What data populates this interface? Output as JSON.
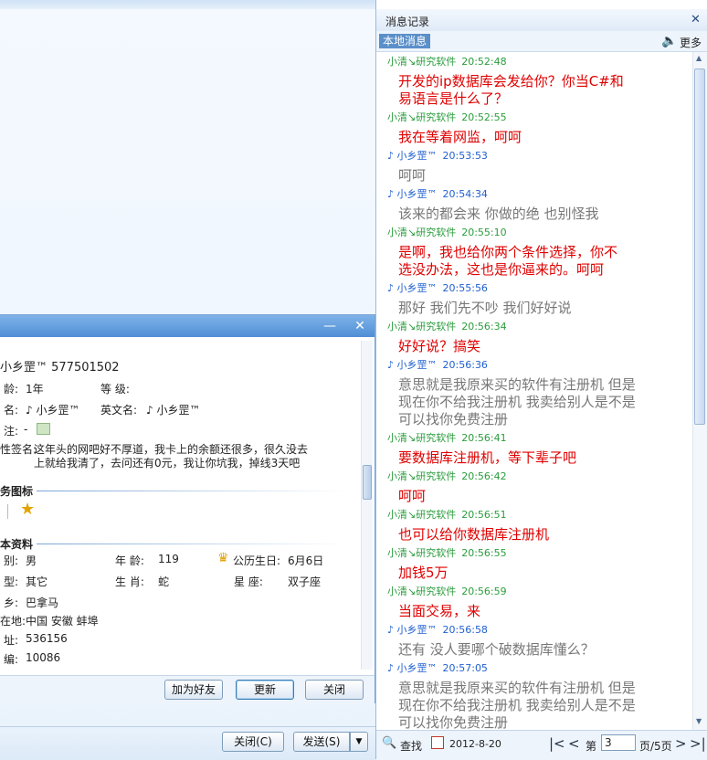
{
  "profile": {
    "name_number": "小乡罡™   577501502",
    "age_label": "龄:",
    "age_value": "1年",
    "level_label": "等  级:",
    "nick_label": "名:",
    "nick_value": "♪ 小乡罡™",
    "en_label": "英文名:",
    "en_value": "♪ 小乡罡™",
    "note_label": "注:",
    "note_value": "-",
    "sign_label": "性签名:",
    "sign_line1": "这年头的网吧好不厚道，我卡上的余额还很多，很久没去",
    "sign_line2": "上就给我清了，去问还有0元，我让你坑我，掉线3天吧",
    "icons_title": "务图标",
    "detail_title": "本资料",
    "gender_label": "别:",
    "gender_value": "男",
    "age2_label": "年  龄:",
    "age2_value": "119",
    "birthday_label": "公历生日:",
    "birthday_value": "6月6日",
    "blood_label": "型:",
    "blood_value": "其它",
    "zodiac_label": "生  肖:",
    "zodiac_value": "蛇",
    "star_label": "星  座:",
    "star_value": "双子座",
    "home_label": "乡:",
    "home_value": "巴拿马",
    "loc_label": "在地:",
    "loc_value": "中国 安徽 蚌埠",
    "addr_label": "址:",
    "addr_value": "536156",
    "zip_label": "编:",
    "zip_value": "10086",
    "buttons": {
      "add_friend": "加为好友",
      "update": "更新",
      "close": "关闭"
    },
    "title_controls": {
      "minimize": "—",
      "close": "✕"
    }
  },
  "chat_bottom": {
    "close": "关闭(C)",
    "send": "发送(S)",
    "dropdown": "▼"
  },
  "history": {
    "title": "消息记录",
    "close_glyph": "✕",
    "tab_local": "本地消息",
    "more": "更多",
    "messages": [
      {
        "sender": "小清↘研究软件",
        "time": "20:52:48",
        "side": "other",
        "lines": [
          "开发的ip数据库会发给你？你当C#和",
          "易语言是什么了？"
        ]
      },
      {
        "sender": "小清↘研究软件",
        "time": "20:52:55",
        "side": "other",
        "lines": [
          "我在等着网监，呵呵"
        ]
      },
      {
        "sender": "♪ 小乡罡™",
        "time": "20:53:53",
        "side": "me",
        "lines": [
          "呵呵"
        ]
      },
      {
        "sender": "♪ 小乡罡™",
        "time": "20:54:34",
        "side": "me",
        "lines": [
          "该来的都会来   你做的绝 也别怪我"
        ]
      },
      {
        "sender": "小清↘研究软件",
        "time": "20:55:10",
        "side": "other",
        "lines": [
          "是啊，我也给你两个条件选择，你不",
          "选没办法，这也是你逼来的。呵呵"
        ]
      },
      {
        "sender": "♪ 小乡罡™",
        "time": "20:55:56",
        "side": "me",
        "lines": [
          "那好 我们先不吵   我们好好说"
        ]
      },
      {
        "sender": "小清↘研究软件",
        "time": "20:56:34",
        "side": "other",
        "lines": [
          "好好说？搞笑"
        ]
      },
      {
        "sender": "♪ 小乡罡™",
        "time": "20:56:36",
        "side": "me",
        "lines": [
          "意思就是我原来买的软件有注册机 但是",
          "现在你不给我注册机 我卖给别人是不是",
          "可以找你免费注册"
        ]
      },
      {
        "sender": "小清↘研究软件",
        "time": "20:56:41",
        "side": "other",
        "lines": [
          "要数据库注册机，等下辈子吧"
        ]
      },
      {
        "sender": "小清↘研究软件",
        "time": "20:56:42",
        "side": "other",
        "lines": [
          "呵呵"
        ]
      },
      {
        "sender": "小清↘研究软件",
        "time": "20:56:51",
        "side": "other",
        "lines": [
          "也可以给你数据库注册机"
        ]
      },
      {
        "sender": "小清↘研究软件",
        "time": "20:56:55",
        "side": "other",
        "lines": [
          "加钱5万"
        ]
      },
      {
        "sender": "小清↘研究软件",
        "time": "20:56:59",
        "side": "other",
        "lines": [
          "当面交易，来"
        ]
      },
      {
        "sender": "♪ 小乡罡™",
        "time": "20:56:58",
        "side": "me",
        "lines": [
          "还有   没人要哪个破数据库懂么？"
        ]
      },
      {
        "sender": "♪ 小乡罡™",
        "time": "20:57:05",
        "side": "me",
        "lines": [
          "意思就是我原来买的软件有注册机 但是",
          "现在你不给我注册机 我卖给别人是不是",
          "可以找你免费注册"
        ]
      }
    ],
    "footer": {
      "search": "查找",
      "date": "2012-8-20",
      "page_prefix": "第",
      "page_value": "3",
      "page_suffix": "页/5页"
    }
  },
  "colors": {
    "other_sender": "#2a9d3c",
    "me_sender": "#1f5fd0",
    "other_text": "#e00000",
    "me_text": "#777777"
  }
}
